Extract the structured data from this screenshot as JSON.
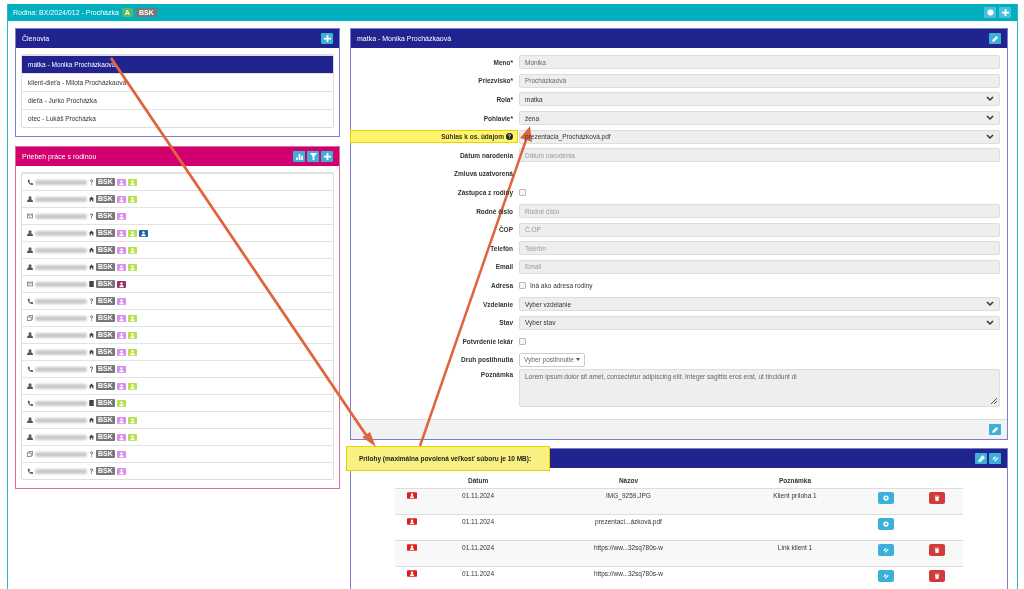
{
  "topbar": {
    "title": "Rodina: BX/2024/012 - Procházka",
    "badges": [
      {
        "text": "A",
        "color": "#5cb85c"
      },
      {
        "text": "BSK",
        "color": "#777777"
      }
    ],
    "buttons": [
      {
        "kind": "info"
      },
      {
        "kind": "plus"
      }
    ]
  },
  "members": {
    "title": "Členovia",
    "items": [
      {
        "label": "matka - Monika Procházkaová",
        "selected": true
      },
      {
        "label": "klient-dieťa - Milota Procházkaová",
        "selected": false
      },
      {
        "label": "dieťa - Jurko Procházka",
        "selected": false
      },
      {
        "label": "otec - Lukáš Procházka",
        "selected": false
      }
    ]
  },
  "timeline": {
    "title": "Priebeh práce s rodinou",
    "rows": [
      {
        "kind": "phone",
        "place": {
          "kind": "question"
        },
        "tag": "BSK",
        "persons": [
          {
            "color": "#d68ff0"
          },
          {
            "color": "#b8e04a"
          }
        ]
      },
      {
        "kind": "person",
        "place": {
          "kind": "home"
        },
        "tag": "BSK",
        "persons": [
          {
            "color": "#d68ff0"
          },
          {
            "color": "#b8e04a"
          }
        ]
      },
      {
        "kind": "mail",
        "place": {
          "kind": "question"
        },
        "tag": "BSK",
        "persons": [
          {
            "color": "#d68ff0"
          }
        ]
      },
      {
        "kind": "person",
        "place": {
          "kind": "home"
        },
        "tag": "BSK",
        "persons": [
          {
            "color": "#d68ff0"
          },
          {
            "color": "#b8e04a"
          },
          {
            "color": "#1f5fa8"
          }
        ]
      },
      {
        "kind": "person",
        "place": {
          "kind": "home"
        },
        "tag": "BSK",
        "persons": [
          {
            "color": "#d68ff0"
          },
          {
            "color": "#b8e04a"
          }
        ]
      },
      {
        "kind": "person",
        "place": {
          "kind": "home"
        },
        "tag": "BSK",
        "persons": [
          {
            "color": "#d68ff0"
          },
          {
            "color": "#b8e04a"
          }
        ]
      },
      {
        "kind": "mail",
        "place": {
          "kind": "building"
        },
        "tag": "BSK",
        "persons": [
          {
            "color": "#9c2f6e"
          }
        ]
      },
      {
        "kind": "phone",
        "place": {
          "kind": "question"
        },
        "tag": "BSK",
        "persons": [
          {
            "color": "#d68ff0"
          }
        ]
      },
      {
        "kind": "copy",
        "place": {
          "kind": "question"
        },
        "tag": "BSK",
        "persons": [
          {
            "color": "#d68ff0"
          },
          {
            "color": "#b8e04a"
          }
        ]
      },
      {
        "kind": "person",
        "place": {
          "kind": "home"
        },
        "tag": "BSK",
        "persons": [
          {
            "color": "#d68ff0"
          },
          {
            "color": "#b8e04a"
          }
        ]
      },
      {
        "kind": "person",
        "place": {
          "kind": "home"
        },
        "tag": "BSK",
        "persons": [
          {
            "color": "#d68ff0"
          },
          {
            "color": "#b8e04a"
          }
        ]
      },
      {
        "kind": "phone",
        "place": {
          "kind": "question"
        },
        "tag": "BSK",
        "persons": [
          {
            "color": "#d68ff0"
          }
        ]
      },
      {
        "kind": "person",
        "place": {
          "kind": "home"
        },
        "tag": "BSK",
        "persons": [
          {
            "color": "#d68ff0"
          },
          {
            "color": "#b8e04a"
          }
        ]
      },
      {
        "kind": "phone",
        "place": {
          "kind": "building"
        },
        "tag": "BSK",
        "persons": [
          {
            "color": "#b8e04a"
          }
        ]
      },
      {
        "kind": "person",
        "place": {
          "kind": "home"
        },
        "tag": "BSK",
        "persons": [
          {
            "color": "#d68ff0"
          },
          {
            "color": "#b8e04a"
          }
        ]
      },
      {
        "kind": "person",
        "place": {
          "kind": "home"
        },
        "tag": "BSK",
        "persons": [
          {
            "color": "#d68ff0"
          },
          {
            "color": "#b8e04a"
          }
        ]
      },
      {
        "kind": "copy",
        "place": {
          "kind": "question"
        },
        "tag": "BSK",
        "persons": [
          {
            "color": "#d68ff0"
          }
        ]
      },
      {
        "kind": "phone",
        "place": {
          "kind": "question"
        },
        "tag": "BSK",
        "persons": [
          {
            "color": "#d68ff0"
          }
        ]
      }
    ]
  },
  "detail": {
    "title": "matka - Monika Procházkaová",
    "fields": [
      {
        "label": "Meno*",
        "kind": "text",
        "value": "Monika"
      },
      {
        "label": "Priezvisko*",
        "kind": "text",
        "value": "Procházkaová"
      },
      {
        "label": "Rola*",
        "kind": "select",
        "value": "matka"
      },
      {
        "label": "Pohlavie*",
        "kind": "select",
        "value": "žena"
      },
      {
        "label": "Súhlas k os. údajom",
        "kind": "select",
        "value": "prezentacia_Procházková.pdf",
        "help": true,
        "highlighted": true
      },
      {
        "label": "Dátum narodenia",
        "kind": "text",
        "placeholder": "Dátum narodenia"
      },
      {
        "label": "Zmluva uzatvorená",
        "kind": "label_only"
      },
      {
        "label": "Zástupca z rodiny",
        "kind": "checkbox",
        "checked": false
      },
      {
        "label": "Rodné číslo",
        "kind": "text",
        "placeholder": "Rodné číslo"
      },
      {
        "label": "ČOP",
        "kind": "text",
        "placeholder": "Č.OP"
      },
      {
        "label": "Telefón",
        "kind": "text",
        "placeholder": "Telefón"
      },
      {
        "label": "Email",
        "kind": "text",
        "placeholder": "Email"
      },
      {
        "label": "Adresa",
        "kind": "checkbox",
        "checked": false,
        "text": "Iná ako adresa rodiny"
      },
      {
        "label": "Vzdelanie",
        "kind": "select",
        "value": "Vyber vzdelanie"
      },
      {
        "label": "Stav",
        "kind": "select",
        "value": "Vyber stav"
      },
      {
        "label": "Potvrdenie lekár",
        "kind": "checkbox",
        "checked": false
      },
      {
        "label": "Druh postihnutia",
        "kind": "dropdown",
        "value": "Vyber postihnutie"
      },
      {
        "label": "Poznámka",
        "kind": "textarea",
        "value": "Lorem ipsum dolor sit amet, consectetur adipiscing elit. Integer sagittis eros erat, ut tincidunt di"
      }
    ]
  },
  "attachments": {
    "title": "Prílohy (maximálna povolená veľkosť súboru je 10 MB):",
    "highlighted": true,
    "columns": [
      "Dátum",
      "Názov",
      "Poznámka"
    ],
    "rows": [
      {
        "date": "01.11.2024",
        "name": "IMG_9259.JPG",
        "note": "Klient príloha 1",
        "kind": "view",
        "deletable": true
      },
      {
        "date": "01.11.2024",
        "name": "prezentaci...ázková.pdf",
        "kind": "view",
        "deletable": false
      },
      {
        "date": "01.11.2024",
        "name": "https://ww...32sq780s-w",
        "note": "Link klient 1",
        "kind": "link",
        "deletable": true
      },
      {
        "date": "01.11.2024",
        "name": "https://ww...32sq780s-w",
        "kind": "link",
        "deletable": true
      }
    ]
  }
}
